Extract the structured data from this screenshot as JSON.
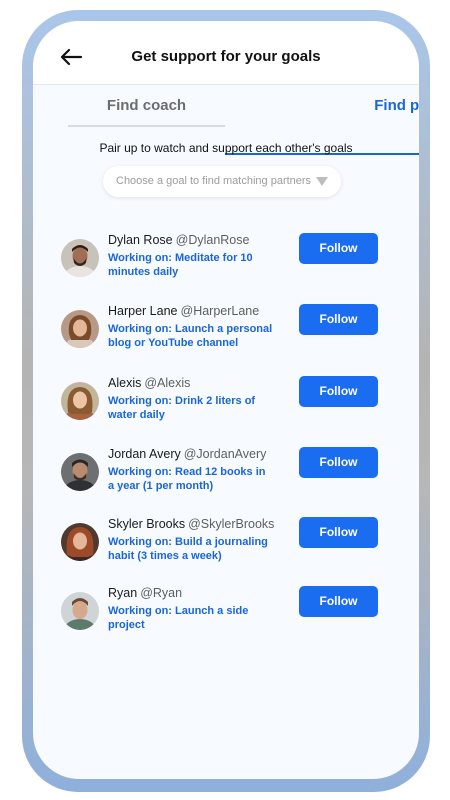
{
  "header": {
    "title": "Get support for your goals"
  },
  "tabs": [
    {
      "label": "Find coach",
      "active": false
    },
    {
      "label": "Find partner",
      "active": true
    }
  ],
  "subtitle": "Pair up to watch and support each other's goals",
  "goal_select": {
    "placeholder": "Choose a goal to find matching partners"
  },
  "partners": [
    {
      "name": "Dylan Rose",
      "handle": "@DylanRose",
      "goal": "Working on: Meditate for 10 minutes daily",
      "button": "Follow"
    },
    {
      "name": "Harper Lane",
      "handle": "@HarperLane",
      "goal": "Working on: Launch a personal blog or YouTube channel",
      "button": "Follow"
    },
    {
      "name": "Alexis",
      "handle": "@Alexis",
      "goal": "Working on: Drink 2 liters of water daily",
      "button": "Follow"
    },
    {
      "name": "Jordan Avery",
      "handle": "@JordanAvery",
      "goal": "Working on: Read 12 books in a year (1 per month)",
      "button": "Follow"
    },
    {
      "name": "Skyler Brooks",
      "handle": "@SkylerBrooks",
      "goal": "Working on: Build a journaling habit (3 times a week)",
      "button": "Follow"
    },
    {
      "name": "Ryan",
      "handle": "@Ryan",
      "goal": "Working on: Launch a side project",
      "button": "Follow"
    }
  ],
  "colors": {
    "accent": "#1a66d6",
    "button": "#1a6cf0",
    "screen_bg": "#f7faff"
  }
}
